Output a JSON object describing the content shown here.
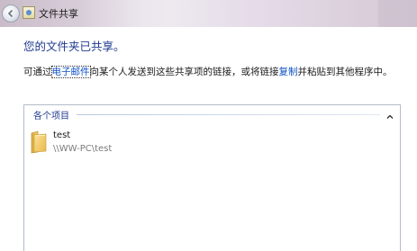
{
  "window": {
    "title": "文件共享"
  },
  "main": {
    "heading": "您的文件夹已共享。",
    "desc_before": "可通过",
    "email_link": "电子邮件",
    "desc_middle": "向某个人发送到这些共享项的链接，或将链接",
    "copy_link": "复制",
    "desc_after": "并粘贴到其他程序中。"
  },
  "items_panel": {
    "group_label": "各个项目",
    "items": [
      {
        "name": "test",
        "path": "\\\\WW-PC\\test",
        "icon": "folder-icon"
      }
    ]
  },
  "colors": {
    "heading": "#1e3a8f",
    "link": "#0b4fc4",
    "path_text": "#7a7a7a"
  }
}
